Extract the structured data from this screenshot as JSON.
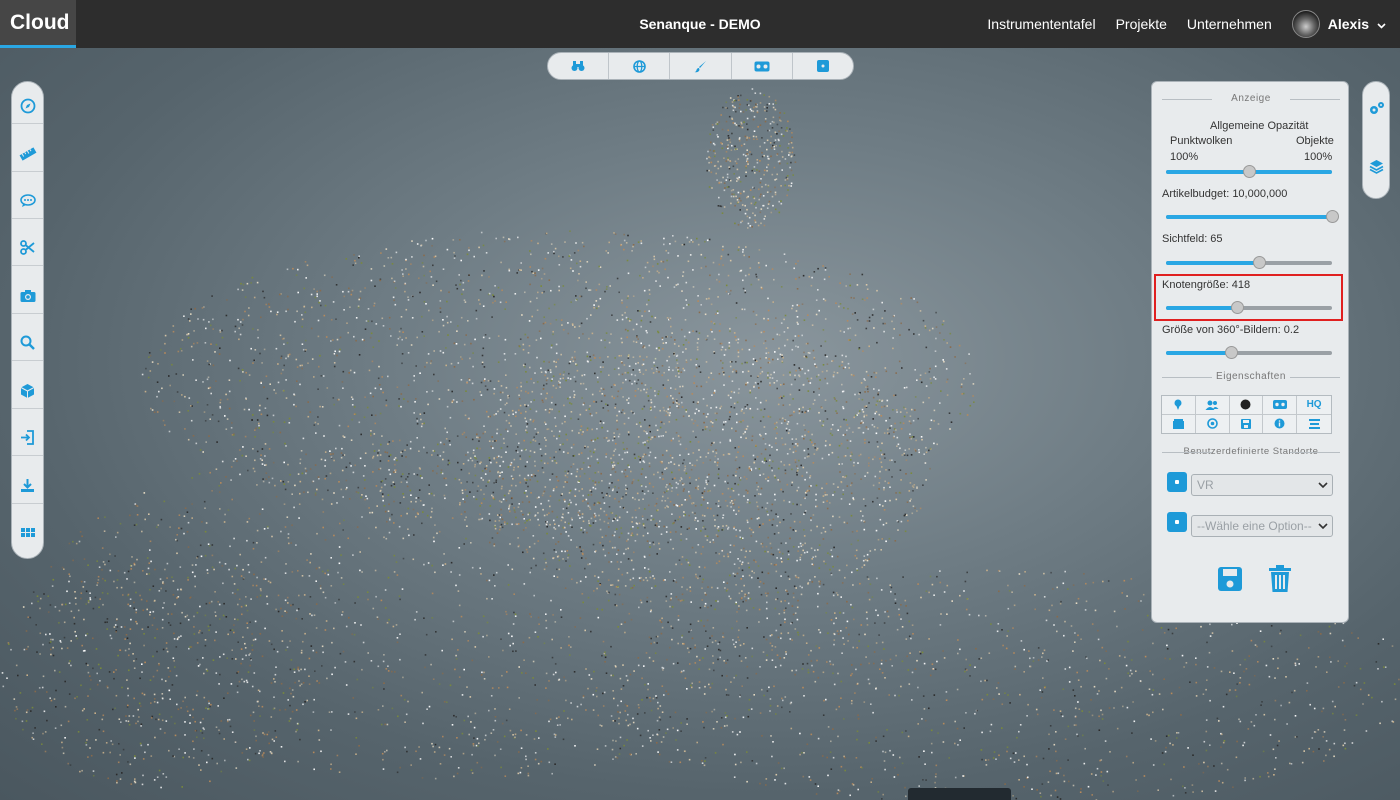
{
  "brand": "Cloud",
  "project_title": "Senanque - DEMO",
  "nav": {
    "dashboard": "Instrumententafel",
    "projects": "Projekte",
    "company": "Unternehmen",
    "user_name": "Alexis"
  },
  "viewbar_icons": [
    "binoculars-icon",
    "globe-icon",
    "brush-icon",
    "vr-headset-icon",
    "panorama-icon"
  ],
  "left_tools_icons": [
    "compass-icon",
    "ruler-icon",
    "comment-icon",
    "scissors-icon",
    "camera-icon",
    "search-icon",
    "cube-icon",
    "import-icon",
    "download-icon",
    "grid-icon"
  ],
  "right_tools_icons": [
    "settings-icon",
    "layers-icon"
  ],
  "panel": {
    "display_heading": "Anzeige",
    "opacity_title": "Allgemeine Opazität",
    "opacity_left_label": "Punktwolken",
    "opacity_right_label": "Objekte",
    "opacity_left_value": "100%",
    "opacity_right_value": "100%",
    "opacity_level": 0.5,
    "budget_label": "Artikelbudget: 10,000,000",
    "budget_level": 1.0,
    "fov_label": "Sichtfeld: 65",
    "fov_level": 0.56,
    "node_size_label": "Knotengröße: 418",
    "node_size_level": 0.43,
    "image360_label": "Größe von 360°-Bildern: 0.2",
    "image360_level": 0.39,
    "properties_heading": "Eigenschaften",
    "property_buttons": [
      "pin-icon",
      "users-icon",
      "dot-icon",
      "vr-headset-icon",
      "HQ",
      "box-icon",
      "target-icon",
      "save-icon",
      "info-icon",
      "list-icon"
    ],
    "hq_label": "HQ",
    "locations_heading": "Benutzerdefinierte Standorte",
    "location_select_1": "VR",
    "location_select_2": "--Wähle eine Option--"
  },
  "colors": {
    "accent": "#1e9ad8",
    "topbar": "#2d2d2d",
    "highlight": "#e02020"
  }
}
